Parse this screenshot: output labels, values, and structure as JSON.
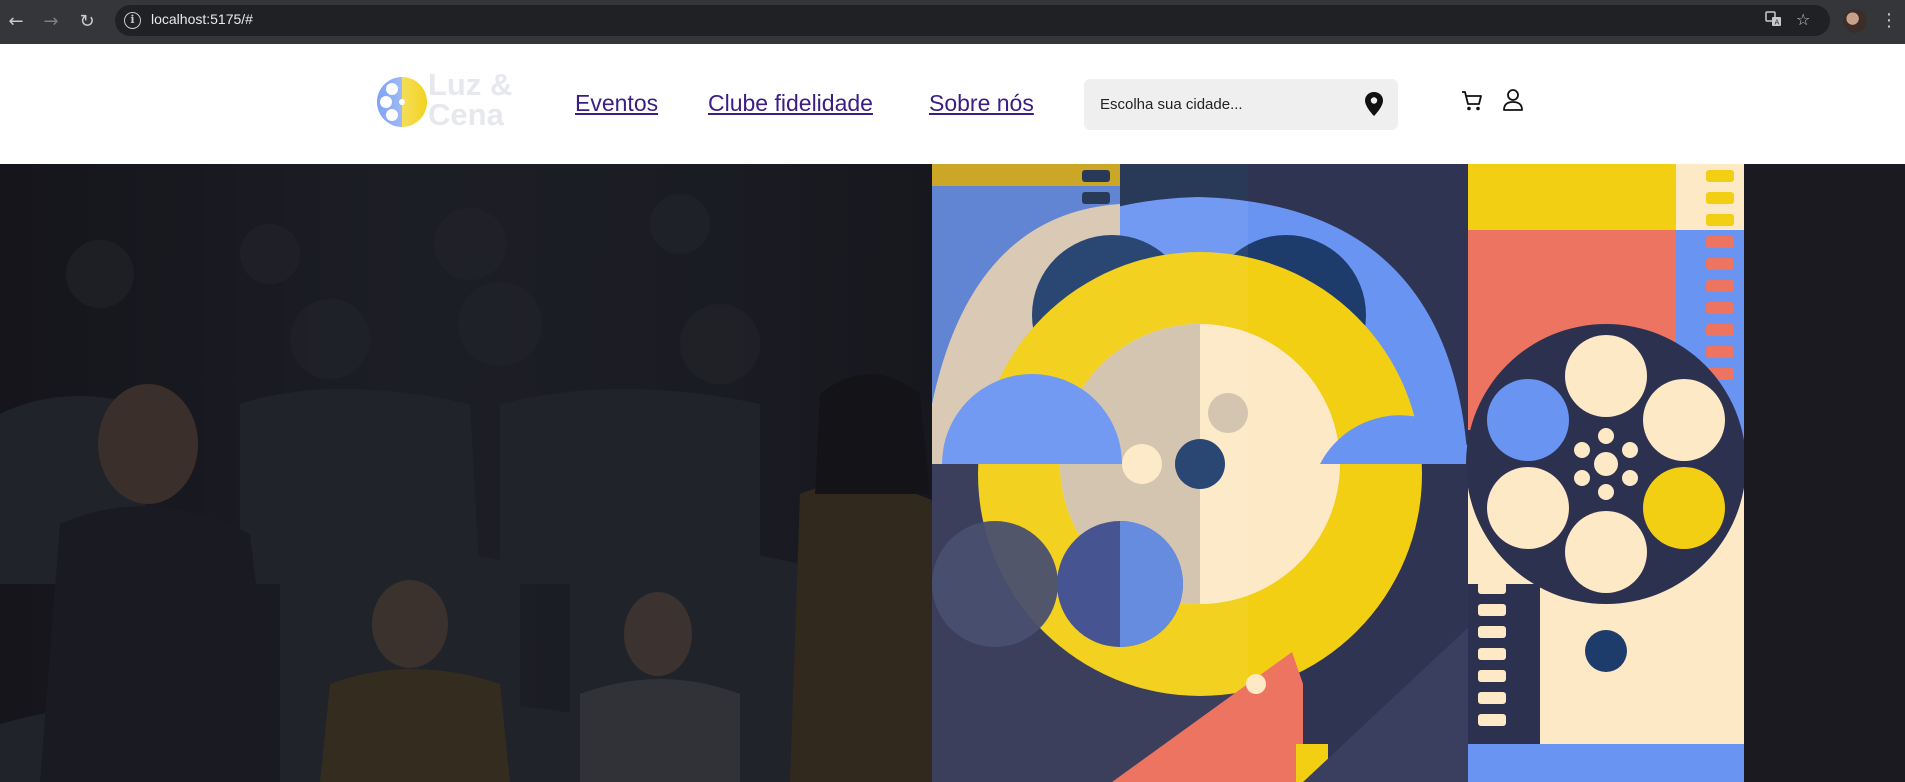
{
  "browser": {
    "url": "localhost:5175/#",
    "icons": [
      "back-icon",
      "forward-icon",
      "reload-icon",
      "site-info-icon",
      "translate-icon",
      "bookmark-star-icon",
      "profile-avatar",
      "menu-kebab-icon"
    ]
  },
  "brand": {
    "line1": "Luz &",
    "line2": "Cena"
  },
  "nav": {
    "eventos": "Eventos",
    "clube": "Clube fidelidade",
    "sobre": "Sobre nós"
  },
  "search": {
    "placeholder": "Escolha sua cidade..."
  },
  "icons": {
    "location": "location-pin-icon",
    "cart": "cart-icon",
    "user": "user-icon"
  },
  "colors": {
    "nav_link": "#3b1d83",
    "header_bg": "#ffffff",
    "accent_blue": "#6b94f2",
    "accent_yellow": "#f2cf13",
    "accent_coral": "#ee7462",
    "cream": "#fde9c6",
    "navy": "#2d3150"
  }
}
